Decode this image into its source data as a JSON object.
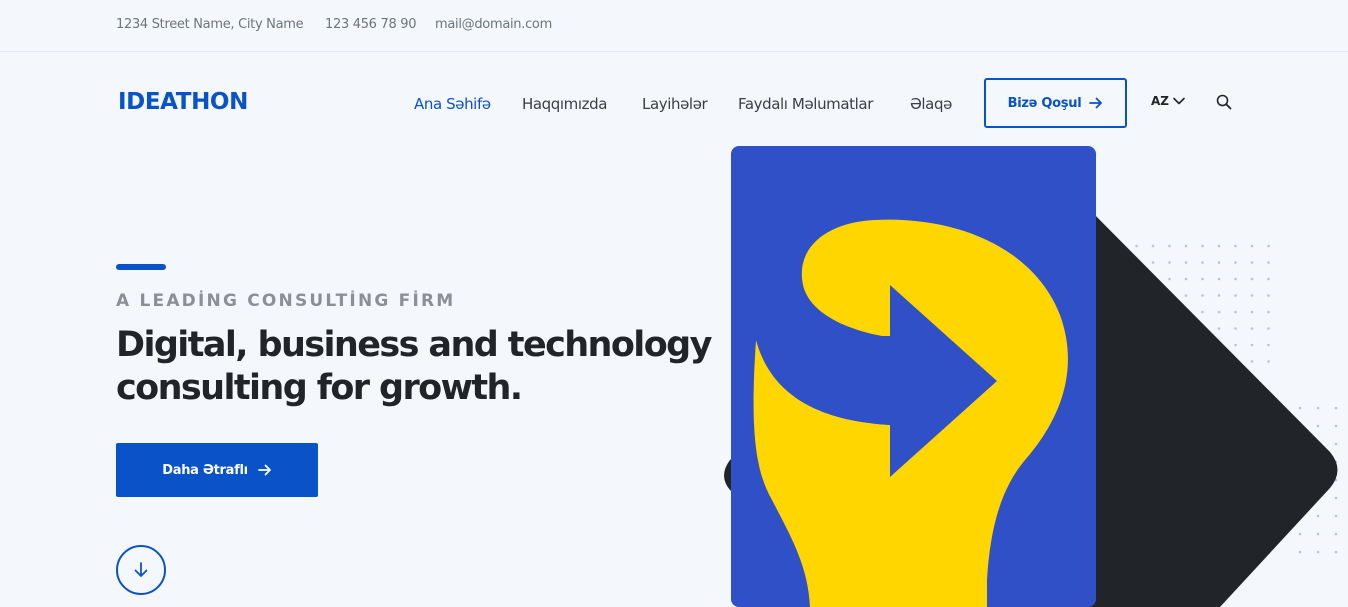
{
  "topbar": {
    "address": "1234 Street Name, City Name",
    "phone": "123 456 78 90",
    "email": "mail@domain.com"
  },
  "header": {
    "logo": "IDEATHON",
    "nav": [
      {
        "label": "Ana Səhifə",
        "active": true
      },
      {
        "label": "Haqqımızda",
        "active": false
      },
      {
        "label": "Layihələr",
        "active": false
      },
      {
        "label": "Faydalı Məlumatlar",
        "active": false
      },
      {
        "label": "Əlaqə",
        "active": false
      }
    ],
    "join_button": "Bizə Qoşul",
    "language": "AZ"
  },
  "hero": {
    "eyebrow": "A LEADİNG CONSULTİNG FİRM",
    "headline": "Digital, business and technology consulting for growth.",
    "cta": "Daha Ətraflı"
  },
  "colors": {
    "accent": "#0a52c8",
    "dark_shape": "#212529",
    "artwork_blue": "#3050c8",
    "artwork_yellow": "#ffd600"
  },
  "icons": {
    "join_arrow": "arrow-right-icon",
    "lang_chevron": "chevron-down-icon",
    "search": "search-icon",
    "cta_arrow": "arrow-right-icon",
    "scroll": "arrow-down-icon"
  }
}
